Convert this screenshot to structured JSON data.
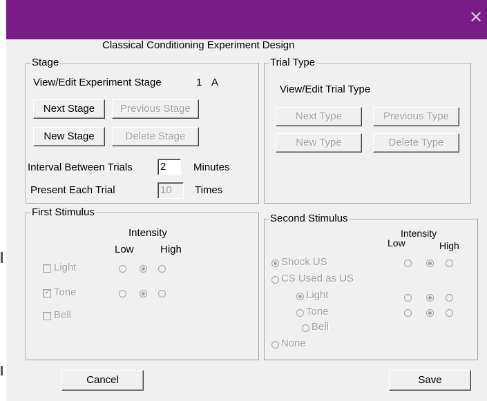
{
  "window": {
    "close_glyph": "✕",
    "title_bar_color": "#7a1c86"
  },
  "heading": "Classical Conditioning Experiment Design",
  "stage": {
    "legend": "Stage",
    "view_edit_label": "View/Edit Experiment Stage",
    "stage_number": "1",
    "stage_letter": "A",
    "next_button": "Next Stage",
    "previous_button": "Previous Stage",
    "new_button": "New Stage",
    "delete_button": "Delete Stage",
    "interval_label": "Interval Between Trials",
    "interval_value": "2",
    "interval_unit": "Minutes",
    "present_label": "Present Each Trial",
    "present_value": "10",
    "present_unit": "Times"
  },
  "trial_type": {
    "legend": "Trial Type",
    "view_edit_label": "View/Edit Trial Type",
    "next_button": "Next Type",
    "previous_button": "Previous Type",
    "new_button": "New Type",
    "delete_button": "Delete Type"
  },
  "first_stimulus": {
    "legend": "First Stimulus",
    "intensity_label": "Intensity",
    "low_label": "Low",
    "high_label": "High",
    "rows": [
      {
        "label": "Light",
        "checked": false,
        "intensity": 2
      },
      {
        "label": "Tone",
        "checked": true,
        "intensity": 2
      },
      {
        "label": "Bell",
        "checked": false,
        "intensity": null
      }
    ]
  },
  "second_stimulus": {
    "legend": "Second Stimulus",
    "intensity_label": "Intensity",
    "low_label": "Low",
    "high_label": "High",
    "options": [
      "Shock US",
      "CS Used as US",
      "None"
    ],
    "selected_option": "Shock US",
    "cs_options": [
      "Light",
      "Tone",
      "Bell"
    ],
    "selected_cs": "Light",
    "shock_intensity": 2,
    "light_intensity": 2,
    "tone_intensity": 2
  },
  "footer": {
    "cancel_button": "Cancel",
    "save_button": "Save"
  }
}
